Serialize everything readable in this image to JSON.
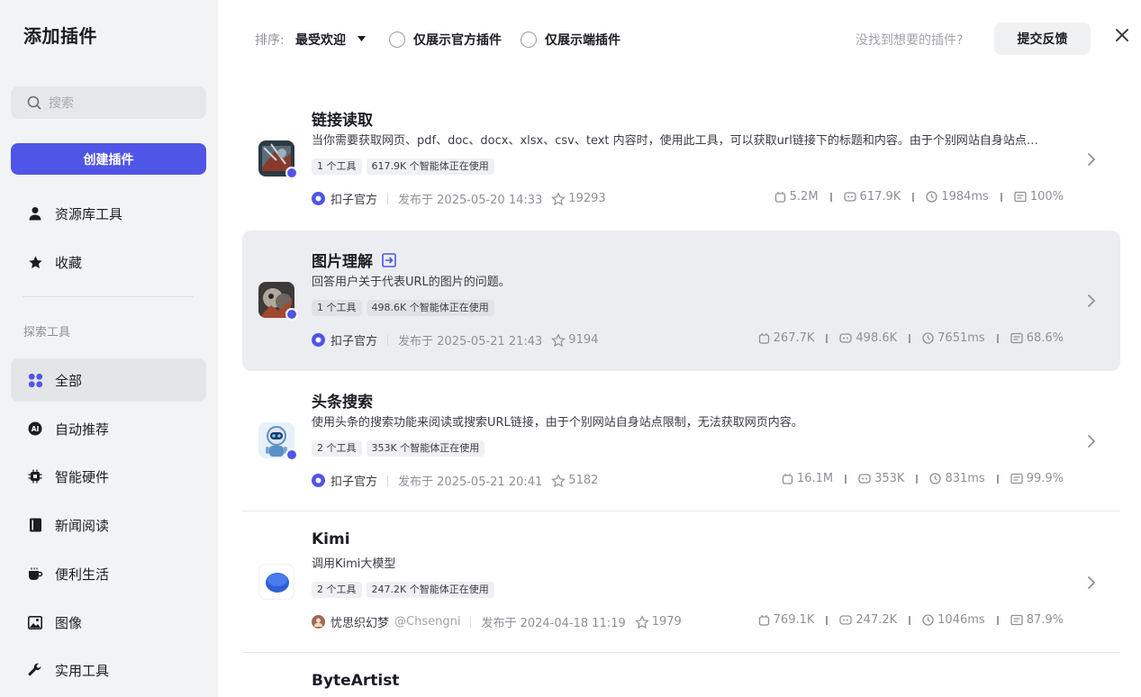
{
  "sidebar": {
    "title": "添加插件",
    "search_placeholder": "搜索",
    "create_label": "创建插件",
    "items": [
      {
        "label": "资源库工具",
        "icon": "person-icon"
      },
      {
        "label": "收藏",
        "icon": "star-icon"
      }
    ],
    "section_label": "探索工具",
    "categories": [
      {
        "label": "全部",
        "icon": "grid-icon",
        "active": true
      },
      {
        "label": "自动推荐",
        "icon": "ai-icon"
      },
      {
        "label": "智能硬件",
        "icon": "chip-icon"
      },
      {
        "label": "新闻阅读",
        "icon": "book-icon"
      },
      {
        "label": "便利生活",
        "icon": "cup-icon"
      },
      {
        "label": "图像",
        "icon": "image-icon"
      },
      {
        "label": "实用工具",
        "icon": "wrench-icon"
      }
    ]
  },
  "topbar": {
    "sort_label": "排序:",
    "sort_value": "最受欢迎",
    "filter_official": "仅展示官方插件",
    "filter_client": "仅展示端插件",
    "not_found": "没找到想要的插件?",
    "feedback_label": "提交反馈"
  },
  "plugins": [
    {
      "name": "链接读取",
      "desc": "当你需要获取网页、pdf、doc、docx、xlsx、csv、text 内容时，使用此工具，可以获取url链接下的标题和内容。由于个别网站自身站点…",
      "tags": [
        "1 个工具",
        "617.9K 个智能体正在使用"
      ],
      "author": "扣子官方",
      "published": "发布于 2025-05-20 14:33",
      "stars": "19293",
      "calls": "5.2M",
      "bots": "617.9K",
      "latency": "1984ms",
      "success": "100%"
    },
    {
      "name": "图片理解",
      "desc": "回答用户关于代表URL的图片的问题。",
      "tags": [
        "1 个工具",
        "498.6K 个智能体正在使用"
      ],
      "author": "扣子官方",
      "published": "发布于 2025-05-21 21:43",
      "stars": "9194",
      "calls": "267.7K",
      "bots": "498.6K",
      "latency": "7651ms",
      "success": "68.6%"
    },
    {
      "name": "头条搜索",
      "desc": "使用头条的搜索功能来阅读或搜索URL链接，由于个别网站自身站点限制，无法获取网页内容。",
      "tags": [
        "2 个工具",
        "353K 个智能体正在使用"
      ],
      "author": "扣子官方",
      "published": "发布于 2025-05-21 20:41",
      "stars": "5182",
      "calls": "16.1M",
      "bots": "353K",
      "latency": "831ms",
      "success": "99.9%"
    },
    {
      "name": "Kimi",
      "desc": "调用Kimi大模型",
      "tags": [
        "2 个工具",
        "247.2K 个智能体正在使用"
      ],
      "author": "忧思织幻梦",
      "handle": "@Chsengni",
      "published": "发布于 2024-04-18 11:19",
      "stars": "1979",
      "calls": "769.1K",
      "bots": "247.2K",
      "latency": "1046ms",
      "success": "87.9%"
    },
    {
      "name": "ByteArtist"
    }
  ]
}
